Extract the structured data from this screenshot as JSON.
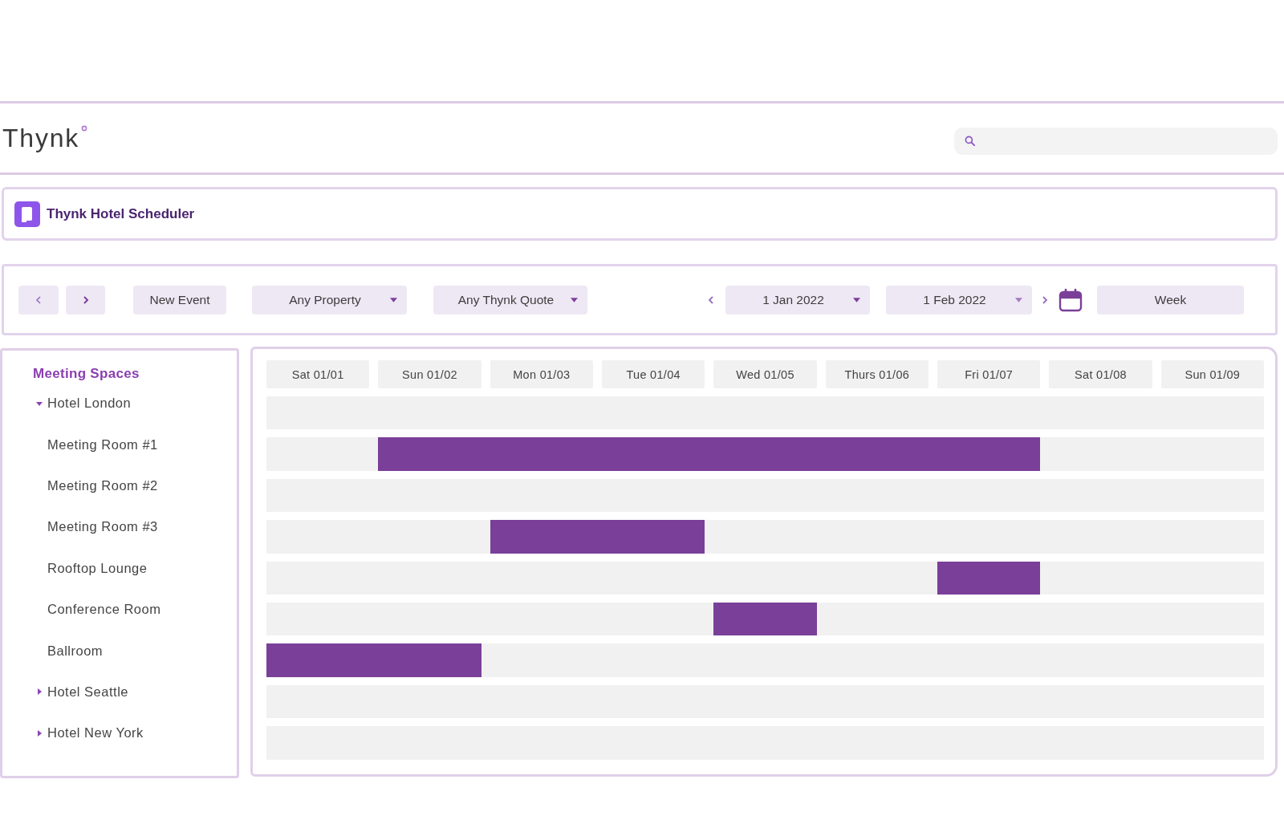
{
  "header": {
    "logo": "Thynk"
  },
  "app_bar": {
    "title": "Thynk Hotel Scheduler"
  },
  "toolbar": {
    "new_event": "New Event",
    "filters": [
      "Any Property",
      "Any Thynk Quote"
    ],
    "date_from": "1 Jan 2022",
    "date_to": "1 Feb 2022",
    "view": "Week"
  },
  "sidebar": {
    "title": "Meeting Spaces",
    "items": [
      {
        "label": "Hotel London",
        "expanded": true,
        "children": [
          {
            "label": "Meeting Room #1"
          },
          {
            "label": "Meeting Room #2"
          },
          {
            "label": "Meeting Room #3"
          },
          {
            "label": "Rooftop Lounge"
          },
          {
            "label": "Conference Room"
          },
          {
            "label": "Ballroom"
          }
        ]
      },
      {
        "label": "Hotel Seattle",
        "expanded": false
      },
      {
        "label": "Hotel New York",
        "expanded": false
      }
    ]
  },
  "schedule": {
    "days": [
      "Sat 01/01",
      "Sun 01/02",
      "Mon 01/03",
      "Tue 01/04",
      "Wed 01/05",
      "Thurs 01/06",
      "Fri 01/07",
      "Sat 01/08",
      "Sun 01/09"
    ],
    "rows": [
      {
        "slots": [
          {
            "kind": "free"
          },
          {
            "kind": "free"
          },
          {
            "kind": "free"
          },
          {
            "kind": "free"
          },
          {
            "kind": "free"
          },
          {
            "kind": "free"
          },
          {
            "kind": "free"
          },
          {
            "kind": "free"
          },
          {
            "kind": "free"
          }
        ]
      },
      {
        "slots": [
          {
            "kind": "free"
          },
          {
            "kind": "booked"
          },
          {
            "kind": "booked"
          },
          {
            "kind": "booked"
          },
          {
            "kind": "booked"
          },
          {
            "kind": "booked"
          },
          {
            "kind": "booked"
          },
          {
            "kind": "free"
          },
          {
            "kind": "free"
          }
        ]
      },
      {
        "slots": [
          {
            "kind": "free"
          },
          {
            "kind": "free"
          },
          {
            "kind": "free"
          },
          {
            "kind": "free"
          },
          {
            "kind": "free"
          },
          {
            "kind": "free"
          },
          {
            "kind": "free"
          },
          {
            "kind": "free"
          },
          {
            "kind": "free"
          }
        ]
      },
      {
        "slots": [
          {
            "kind": "free"
          },
          {
            "kind": "free"
          },
          {
            "kind": "booked"
          },
          {
            "kind": "booked"
          },
          {
            "kind": "free"
          },
          {
            "kind": "free"
          },
          {
            "kind": "free"
          },
          {
            "kind": "free"
          },
          {
            "kind": "free"
          }
        ]
      },
      {
        "slots": [
          {
            "kind": "free"
          },
          {
            "kind": "free"
          },
          {
            "kind": "free"
          },
          {
            "kind": "free"
          },
          {
            "kind": "free"
          },
          {
            "kind": "free"
          },
          {
            "kind": "booked"
          },
          {
            "kind": "free"
          },
          {
            "kind": "free"
          }
        ]
      },
      {
        "slots": [
          {
            "kind": "free"
          },
          {
            "kind": "free"
          },
          {
            "kind": "free"
          },
          {
            "kind": "free"
          },
          {
            "kind": "booked"
          },
          {
            "kind": "free"
          },
          {
            "kind": "free"
          },
          {
            "kind": "free"
          },
          {
            "kind": "free"
          }
        ]
      },
      {
        "slots": [
          {
            "kind": "booked"
          },
          {
            "kind": "booked"
          },
          {
            "kind": "free"
          },
          {
            "kind": "free"
          },
          {
            "kind": "free"
          },
          {
            "kind": "free"
          },
          {
            "kind": "free"
          },
          {
            "kind": "free"
          },
          {
            "kind": "free"
          }
        ]
      },
      {
        "slots": [
          {
            "kind": "free"
          },
          {
            "kind": "free"
          },
          {
            "kind": "free"
          },
          {
            "kind": "free"
          },
          {
            "kind": "free"
          },
          {
            "kind": "free"
          },
          {
            "kind": "free"
          },
          {
            "kind": "free"
          },
          {
            "kind": "free"
          }
        ]
      },
      {
        "slots": [
          {
            "kind": "free"
          },
          {
            "kind": "free"
          },
          {
            "kind": "free"
          },
          {
            "kind": "free"
          },
          {
            "kind": "free"
          },
          {
            "kind": "free"
          },
          {
            "kind": "free"
          },
          {
            "kind": "free"
          },
          {
            "kind": "free"
          }
        ]
      }
    ]
  }
}
